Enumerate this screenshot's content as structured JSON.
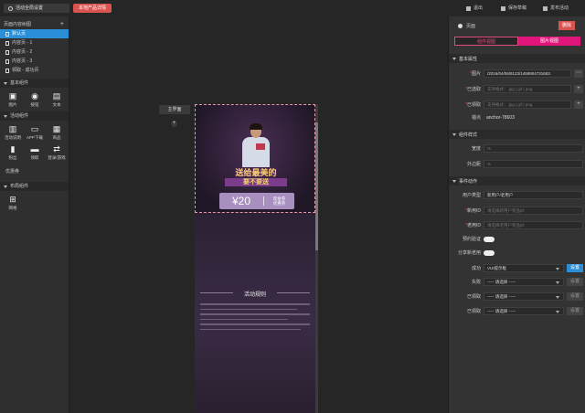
{
  "topbar": {
    "global_settings": "活动全局设置",
    "preview_tag": "本地产品详情",
    "right_buttons": [
      {
        "label": "退出",
        "icon": "exit-icon"
      },
      {
        "label": "保存草稿",
        "icon": "save-icon"
      },
      {
        "label": "发布活动",
        "icon": "publish-icon"
      }
    ]
  },
  "left": {
    "pages_header": "页面内容树图",
    "pages": [
      "默认页",
      "内容页 - 1",
      "内容页 - 2",
      "内容页 - 3",
      "领取 - 成功页"
    ],
    "basic_header": "基本组件",
    "basic": [
      "图片",
      "按钮",
      "文本"
    ],
    "activity_header": "活动组件",
    "activity": [
      "活动说明",
      "APP下载",
      "商品",
      "粉丝",
      "领取",
      "登录/游戏"
    ],
    "extra_label": "优惠券",
    "layout_header": "布局组件",
    "layout": [
      "网格"
    ]
  },
  "canvas": {
    "main_page": "主界面",
    "add_page": "+",
    "banner_title": "送给最美的",
    "banner_sub": "要不要送",
    "coupon_amount": "¥20",
    "coupon_note_1": "现金券",
    "coupon_note_2": "优惠券",
    "rules_title": "活动规则"
  },
  "right": {
    "radio_label": "页面",
    "delete_btn": "删除",
    "tab_off": "组件视图",
    "tab_on": "图片视图",
    "basic_header": "基本属性",
    "image_label": "图片",
    "image_value": "/2016/04/06/9123/1459904731683",
    "selected_label": "已选取",
    "selected_ph": "支持格式：.jpg | gif | png",
    "received_label": "已领取",
    "received_ph": "支持格式：.jpg | gif | png",
    "anchor_label": "锚点",
    "anchor_value": "anchor-78603",
    "style_header": "组件样式",
    "width_label": "宽度",
    "width_ph": "%",
    "margin_label": "外边距",
    "margin_ph": "%",
    "event_header": "事件动作",
    "user_type_label": "用户类型",
    "user_type_value": "新用户/老用户",
    "new_id_label": "新用ID",
    "new_id_ph": "请选择新用户奖品ID",
    "old_id_label": "老用ID",
    "old_id_ph": "请选择老用户奖品ID",
    "verify_label": "预约验证",
    "share_label": "分享新老用",
    "success_label": "成功",
    "success_value": "VUI提示框",
    "success_btn": "设置",
    "fail_label": "失败",
    "fail_value": "----- 请选择 -----",
    "set_btn": "设置",
    "got_label": "已领取",
    "got_value": "----- 请选择 -----",
    "got2_label": "已领取",
    "got2_value": "----- 请选择 -----"
  }
}
